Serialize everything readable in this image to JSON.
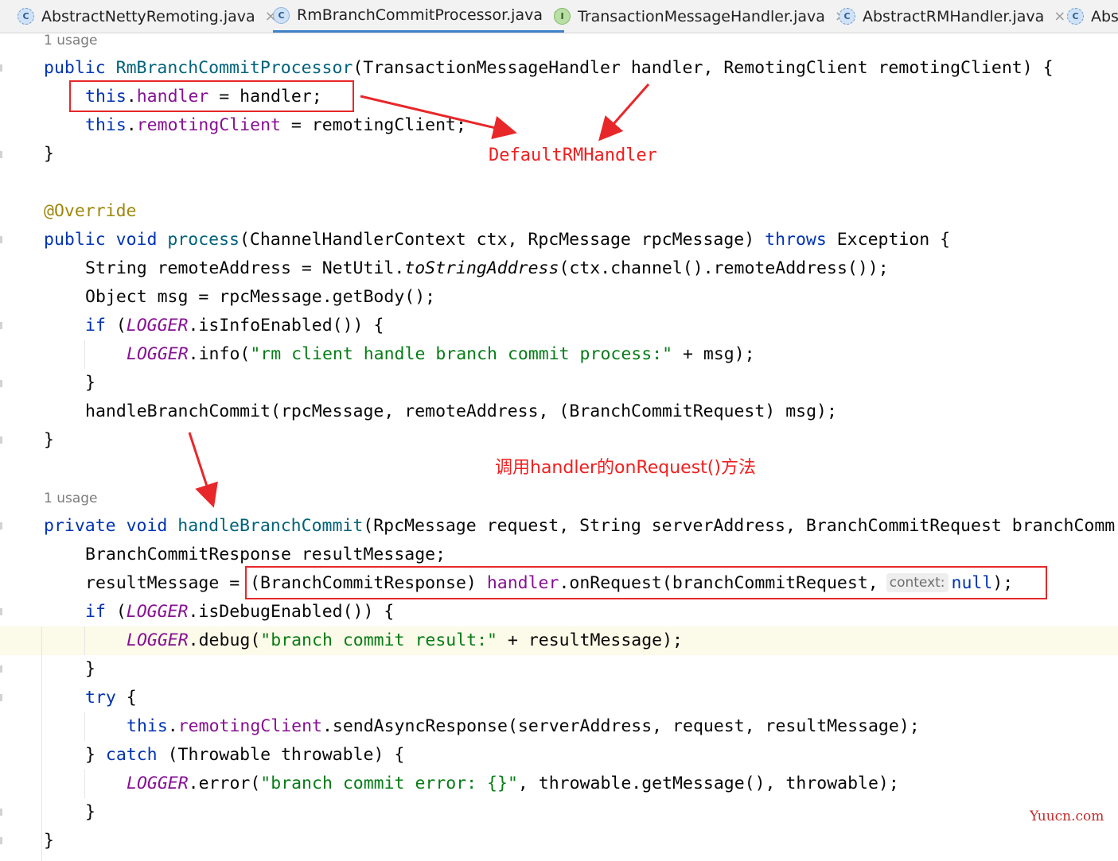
{
  "tabs": [
    {
      "icon": "C",
      "label": "AbstractNettyRemoting.java",
      "close": "×"
    },
    {
      "icon": "C",
      "label": "RmBranchCommitProcessor.java",
      "close": "×",
      "active": true
    },
    {
      "icon": "I",
      "label": "TransactionMessageHandler.java",
      "close": "×"
    },
    {
      "icon": "C",
      "label": "AbstractRMHandler.java",
      "close": "×"
    },
    {
      "icon": "C",
      "label": "Abst"
    }
  ],
  "code": {
    "usage1": "1 usage",
    "usage2": "1 usage",
    "l_ctor": [
      "public",
      " ",
      "RmBranchCommitProcessor",
      "(TransactionMessageHandler handler, RemotingClient remotingClient) {"
    ],
    "l_assign_handler": [
      "this",
      ".",
      "handler",
      " = handler;"
    ],
    "l_assign_client": [
      "this",
      ".",
      "remotingClient",
      " = remotingClient;"
    ],
    "close_brace": "}",
    "annotation": "@Override",
    "l_process": [
      "public",
      " ",
      "void",
      " ",
      "process",
      "(ChannelHandlerContext ctx, RpcMessage rpcMessage) ",
      "throws",
      " Exception {"
    ],
    "l_remote": [
      "String remoteAddress = NetUtil.",
      "toStringAddress",
      "(ctx.channel().remoteAddress());"
    ],
    "l_msg": "Object msg = rpcMessage.getBody();",
    "l_if_info": [
      "if",
      " (",
      "LOGGER",
      ".isInfoEnabled()) {"
    ],
    "l_log_info": [
      "LOGGER",
      ".info(",
      "\"rm client handle branch commit process:\"",
      " + msg);"
    ],
    "l_call": "handleBranchCommit(rpcMessage, remoteAddress, (BranchCommitRequest) msg);",
    "l_private": [
      "private",
      " ",
      "void",
      " ",
      "handleBranchCommit",
      "(RpcMessage request, String serverAddress, BranchCommitRequest branchComm"
    ],
    "l_decl": "BranchCommitResponse resultMessage;",
    "l_result": [
      "resultMessage = (BranchCommitResponse) ",
      "handler",
      ".onRequest(branchCommitRequest,",
      "context:",
      "null",
      ");"
    ],
    "l_if_debug": [
      "if",
      " (",
      "LOGGER",
      ".isDebugEnabled()) {"
    ],
    "l_log_debug": [
      "LOGGER",
      ".debug(",
      "\"branch commit result:\"",
      " + resultMessage);"
    ],
    "l_try": [
      "try",
      " {"
    ],
    "l_send": [
      "this",
      ".",
      "remotingClient",
      ".sendAsyncResponse(serverAddress, request, resultMessage);"
    ],
    "l_catch": [
      "} ",
      "catch",
      " (Throwable throwable) {"
    ],
    "l_log_error": [
      "LOGGER",
      ".error(",
      "\"branch commit error: {}\"",
      ", throwable.getMessage(), throwable);"
    ]
  },
  "annotations": {
    "note1": "DefaultRMHandler",
    "note2": "调用handler的onRequest()方法",
    "watermark": "Yuucn.com"
  },
  "colors": {
    "keyword": "#0033b3",
    "field": "#871094",
    "method": "#00627a",
    "string": "#067d17",
    "annotation": "#9e880d",
    "markup_red": "#e8272a",
    "active_tab": "#4083c9"
  }
}
